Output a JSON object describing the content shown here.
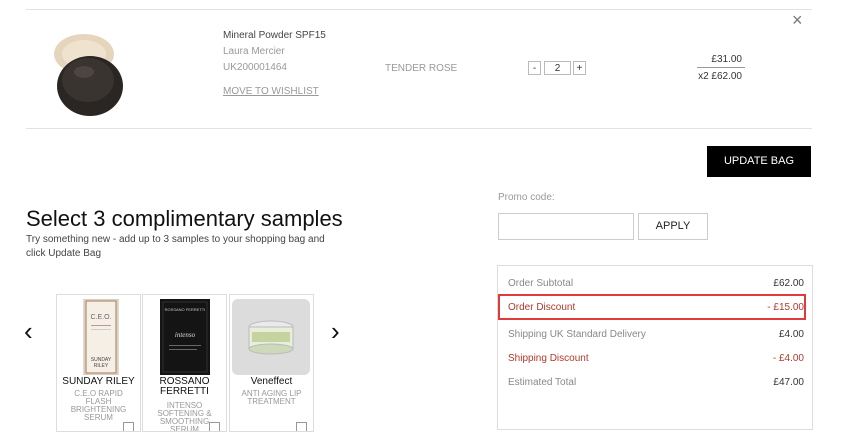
{
  "product": {
    "name": "Mineral Powder SPF15",
    "brand": "Laura Mercier",
    "sku": "UK200001464",
    "wishlist_link": "MOVE TO WISHLIST",
    "shade": "TENDER ROSE",
    "qty_minus": "-",
    "qty_value": "2",
    "qty_plus": "+",
    "unit_price": "£31.00",
    "line_total": "x2 £62.00",
    "remove": "×"
  },
  "update_bag_label": "UPDATE BAG",
  "samples_section": {
    "title": "Select 3 complimentary samples",
    "subtitle": "Try something new - add up to 3 samples to your shopping bag and click Update Bag",
    "prev_arrow": "‹",
    "next_arrow": "›",
    "items": [
      {
        "brand": "SUNDAY RILEY",
        "desc": "C.E.O RAPID FLASH BRIGHTENING SERUM"
      },
      {
        "brand": "ROSSANO FERRETTI",
        "desc": "INTENSO SOFTENING & SMOOTHING SERUM"
      },
      {
        "brand": "Veneffect",
        "desc": "ANTI AGING LIP TREATMENT"
      }
    ]
  },
  "promo": {
    "label": "Promo code:",
    "placeholder": "",
    "apply_label": "APPLY"
  },
  "summary": {
    "subtotal_label": "Order Subtotal",
    "subtotal_value": "£62.00",
    "discount_label": "Order Discount",
    "discount_value": "- £15.00",
    "shipping_label": "Shipping UK Standard Delivery",
    "shipping_value": "£4.00",
    "shipping_discount_label": "Shipping Discount",
    "shipping_discount_value": "- £4.00",
    "total_label": "Estimated Total",
    "total_value": "£47.00"
  },
  "colors": {
    "highlight": "#e03a3a",
    "discount_red": "#b0392c",
    "button_black": "#000000"
  }
}
